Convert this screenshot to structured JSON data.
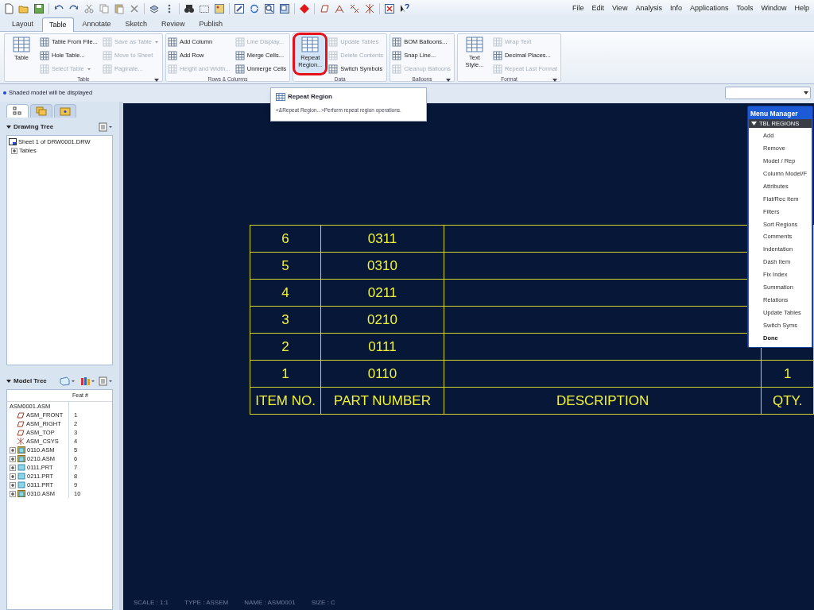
{
  "menu_bar": [
    "File",
    "Edit",
    "View",
    "Analysis",
    "Info",
    "Applications",
    "Tools",
    "Window",
    "Help"
  ],
  "tabs": [
    {
      "label": "Layout",
      "selected": false
    },
    {
      "label": "Table",
      "selected": true
    },
    {
      "label": "Annotate",
      "selected": false
    },
    {
      "label": "Sketch",
      "selected": false
    },
    {
      "label": "Review",
      "selected": false
    },
    {
      "label": "Publish",
      "selected": false
    }
  ],
  "ribbon": {
    "groups": [
      {
        "title": "Table",
        "has_launcher": true,
        "large": {
          "label": "Table",
          "highlighted": false
        },
        "columns": [
          [
            {
              "label": "Table From File...",
              "disabled": false,
              "dropdown": false
            },
            {
              "label": "Hole Table...",
              "disabled": false,
              "dropdown": false
            },
            {
              "label": "Select Table",
              "disabled": true,
              "dropdown": true
            }
          ],
          [
            {
              "label": "Save as Table",
              "disabled": true,
              "dropdown": true
            },
            {
              "label": "Move to Sheet",
              "disabled": true,
              "dropdown": false
            },
            {
              "label": "Paginate...",
              "disabled": true,
              "dropdown": false
            }
          ]
        ]
      },
      {
        "title": "Rows & Columns",
        "has_launcher": false,
        "columns": [
          [
            {
              "label": "Add Column",
              "disabled": false,
              "dropdown": false
            },
            {
              "label": "Add Row",
              "disabled": false,
              "dropdown": false
            },
            {
              "label": "Height and Width...",
              "disabled": true,
              "dropdown": false
            }
          ],
          [
            {
              "label": "Line Display...",
              "disabled": true,
              "dropdown": false
            },
            {
              "label": "Merge Cells...",
              "disabled": false,
              "dropdown": false
            },
            {
              "label": "Unmerge Cells",
              "disabled": false,
              "dropdown": false
            }
          ]
        ]
      },
      {
        "title": "Data",
        "has_launcher": false,
        "large": {
          "label": "Repeat Region...",
          "highlighted": true
        },
        "columns": [
          [
            {
              "label": "Update Tables",
              "disabled": true,
              "dropdown": false
            },
            {
              "label": "Delete Contents",
              "disabled": true,
              "dropdown": false
            },
            {
              "label": "Switch Symbols",
              "disabled": false,
              "dropdown": false
            }
          ]
        ]
      },
      {
        "title": "Balloons",
        "has_launcher": true,
        "columns": [
          [
            {
              "label": "BOM Balloons...",
              "disabled": false,
              "dropdown": false
            },
            {
              "label": "Snap Line...",
              "disabled": false,
              "dropdown": false
            },
            {
              "label": "Cleanup Balloons",
              "disabled": true,
              "dropdown": false
            }
          ]
        ]
      },
      {
        "title": "Format",
        "has_launcher": true,
        "large": {
          "label": "Text Style...",
          "highlighted": false
        },
        "columns": [
          [
            {
              "label": "Wrap Text",
              "disabled": true,
              "dropdown": false
            },
            {
              "label": "Decimal Places...",
              "disabled": false,
              "dropdown": false
            },
            {
              "label": "Repeat Last Format",
              "disabled": true,
              "dropdown": false
            }
          ]
        ]
      }
    ]
  },
  "message": "Shaded model will be displayed",
  "tooltip": {
    "title": "Repeat Region",
    "body": "<&Repeat Region...>Perform repeat region operations."
  },
  "left_panel": {
    "tabs": [
      {
        "selected": true
      },
      {
        "selected": false
      },
      {
        "selected": false
      }
    ],
    "drawing_tree": {
      "title": "Drawing Tree",
      "items": [
        {
          "label": "Sheet 1 of DRW0001.DRW",
          "children": [
            {
              "label": "Tables",
              "expanded": false
            }
          ]
        }
      ]
    },
    "model_tree": {
      "title": "Model Tree",
      "column": "Feat #",
      "root": "ASM0001.ASM",
      "items": [
        {
          "label": "ASM_FRONT",
          "feat": "1",
          "kind": "datum_plane"
        },
        {
          "label": "ASM_RIGHT",
          "feat": "2",
          "kind": "datum_plane"
        },
        {
          "label": "ASM_TOP",
          "feat": "3",
          "kind": "datum_plane"
        },
        {
          "label": "ASM_CSYS",
          "feat": "4",
          "kind": "csys"
        },
        {
          "label": "0110.ASM",
          "feat": "5",
          "kind": "assembly",
          "expanded": false
        },
        {
          "label": "0210.ASM",
          "feat": "6",
          "kind": "assembly",
          "expanded": false
        },
        {
          "label": "0111.PRT",
          "feat": "7",
          "kind": "part",
          "expanded": false
        },
        {
          "label": "0211.PRT",
          "feat": "8",
          "kind": "part",
          "expanded": false
        },
        {
          "label": "0311.PRT",
          "feat": "9",
          "kind": "part",
          "expanded": false
        },
        {
          "label": "0310.ASM",
          "feat": "10",
          "kind": "assembly",
          "expanded": false
        }
      ]
    }
  },
  "drawing": {
    "rows": [
      {
        "item_no": "6",
        "part_number": "0311"
      },
      {
        "item_no": "5",
        "part_number": "0310"
      },
      {
        "item_no": "4",
        "part_number": "0211"
      },
      {
        "item_no": "3",
        "part_number": "0210"
      },
      {
        "item_no": "2",
        "part_number": "0111"
      },
      {
        "item_no": "1",
        "part_number": "0110",
        "qty": "1"
      }
    ],
    "header": [
      "ITEM NO.",
      "PART NUMBER",
      "DESCRIPTION",
      "QTY."
    ],
    "status": [
      "SCALE : 1:1",
      "TYPE : ASSEM",
      "NAME : ASM0001",
      "SIZE : C"
    ]
  },
  "menu_manager": {
    "title": "Menu Manager",
    "section": "TBL REGIONS",
    "items": [
      {
        "label": "Add",
        "emphasized": false
      },
      {
        "label": "Remove",
        "emphasized": false
      },
      {
        "label": "Model / Rep",
        "emphasized": false
      },
      {
        "label": "Column Model/F",
        "emphasized": false
      },
      {
        "label": "Attributes",
        "emphasized": false
      },
      {
        "label": "Flat/Rec Item",
        "emphasized": false
      },
      {
        "label": "Filters",
        "emphasized": false
      },
      {
        "label": "Sort Regions",
        "emphasized": false
      },
      {
        "label": "Comments",
        "emphasized": false
      },
      {
        "label": "Indentation",
        "emphasized": false
      },
      {
        "label": "Dash Item",
        "emphasized": false
      },
      {
        "label": "Fix Index",
        "emphasized": false
      },
      {
        "label": "Summation",
        "emphasized": false
      },
      {
        "label": "Relations",
        "emphasized": false
      },
      {
        "label": "Update Tables",
        "emphasized": false
      },
      {
        "label": "Switch Syms",
        "emphasized": false
      },
      {
        "label": "Done",
        "emphasized": true
      }
    ]
  }
}
